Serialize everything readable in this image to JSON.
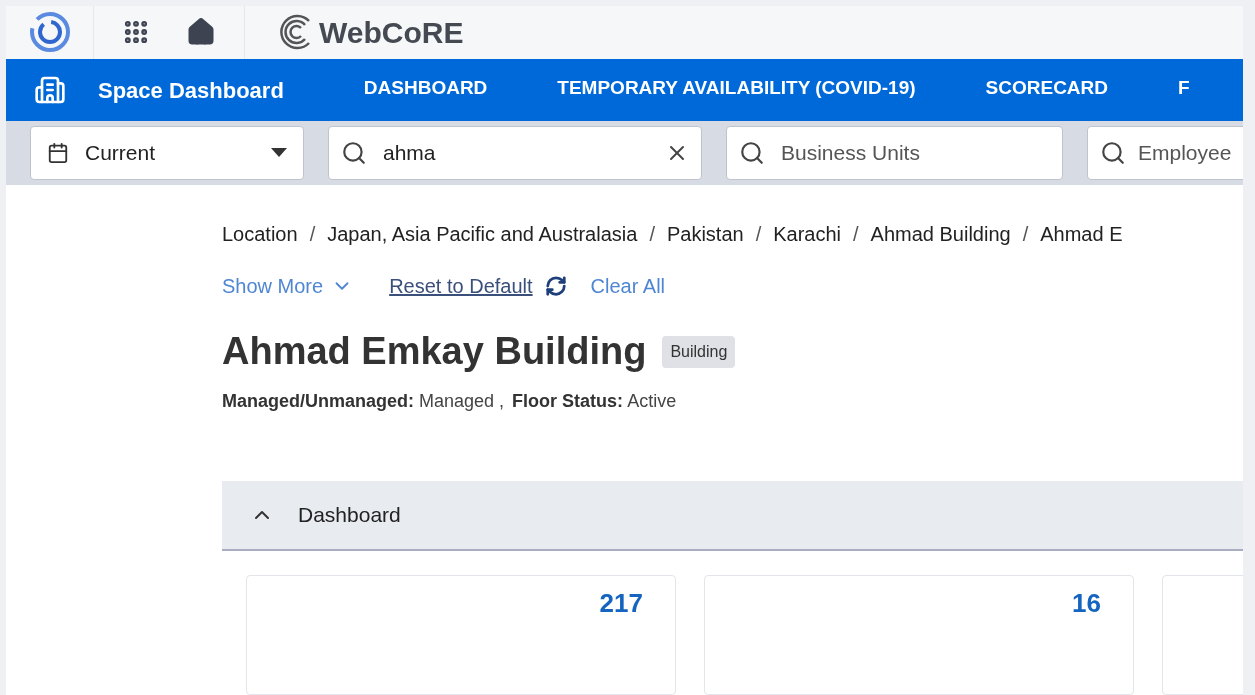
{
  "header": {
    "brand": "WebCoRE"
  },
  "nav": {
    "title": "Space Dashboard",
    "items": [
      {
        "label": "DASHBOARD",
        "selected": false
      },
      {
        "label": "TEMPORARY AVAILABILITY (COVID-19)",
        "selected": false
      },
      {
        "label": "SCORECARD",
        "selected": false
      },
      {
        "label": "F",
        "selected": false
      }
    ]
  },
  "filters": {
    "period": {
      "value": "Current"
    },
    "search": {
      "value": "ahma"
    },
    "business_units": {
      "placeholder": "Business Units"
    },
    "employees": {
      "placeholder": "Employee"
    }
  },
  "breadcrumb": {
    "separator": "/",
    "items": [
      "Location",
      "Japan, Asia Pacific and Australasia",
      "Pakistan",
      "Karachi",
      "Ahmad Building",
      "Ahmad E"
    ]
  },
  "actions": {
    "show_more": "Show More",
    "reset": "Reset to Default",
    "clear": "Clear All"
  },
  "title": "Ahmad Emkay Building",
  "badge": "Building",
  "properties": [
    {
      "label": "Managed/Unmanaged:",
      "value": "Managed ,"
    },
    {
      "label": "Floor Status:",
      "value": "Active"
    }
  ],
  "section": {
    "title": "Dashboard",
    "expanded": true
  },
  "cards": [
    {
      "kind": "stat",
      "value": "217"
    },
    {
      "kind": "stat",
      "value": "16"
    },
    {
      "kind": "partial"
    }
  ]
}
